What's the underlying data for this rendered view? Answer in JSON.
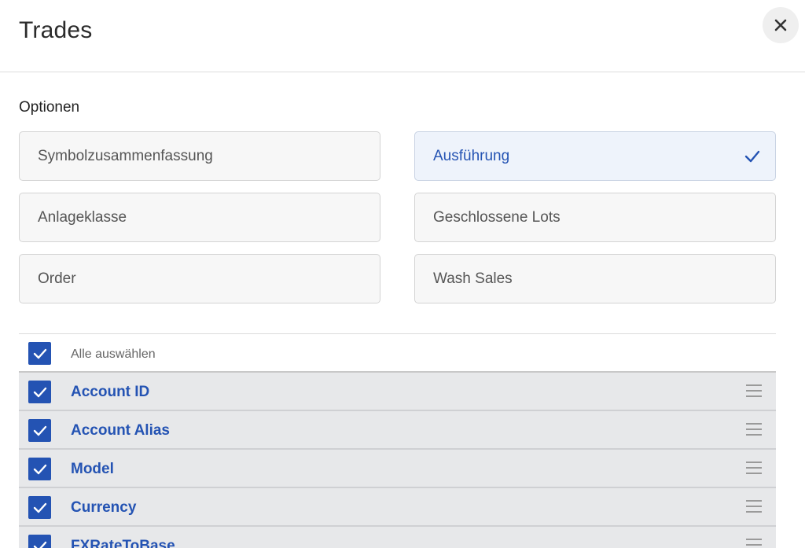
{
  "dialog": {
    "title": "Trades",
    "close_icon": "close-icon"
  },
  "options": {
    "label": "Optionen",
    "items": [
      {
        "label": "Symbolzusammenfassung",
        "selected": false
      },
      {
        "label": "Ausführung",
        "selected": true
      },
      {
        "label": "Anlageklasse",
        "selected": false
      },
      {
        "label": "Geschlossene Lots",
        "selected": false
      },
      {
        "label": "Order",
        "selected": false
      },
      {
        "label": "Wash Sales",
        "selected": false
      }
    ]
  },
  "fields": {
    "select_all_label": "Alle auswählen",
    "select_all_checked": true,
    "rows": [
      {
        "label": "Account ID",
        "checked": true
      },
      {
        "label": "Account Alias",
        "checked": true
      },
      {
        "label": "Model",
        "checked": true
      },
      {
        "label": "Currency",
        "checked": true
      },
      {
        "label": "FXRateToBase",
        "checked": true
      }
    ]
  },
  "colors": {
    "accent": "#2453b3",
    "row_bg": "#e7e8ea",
    "selected_bg": "#eef3fb"
  }
}
